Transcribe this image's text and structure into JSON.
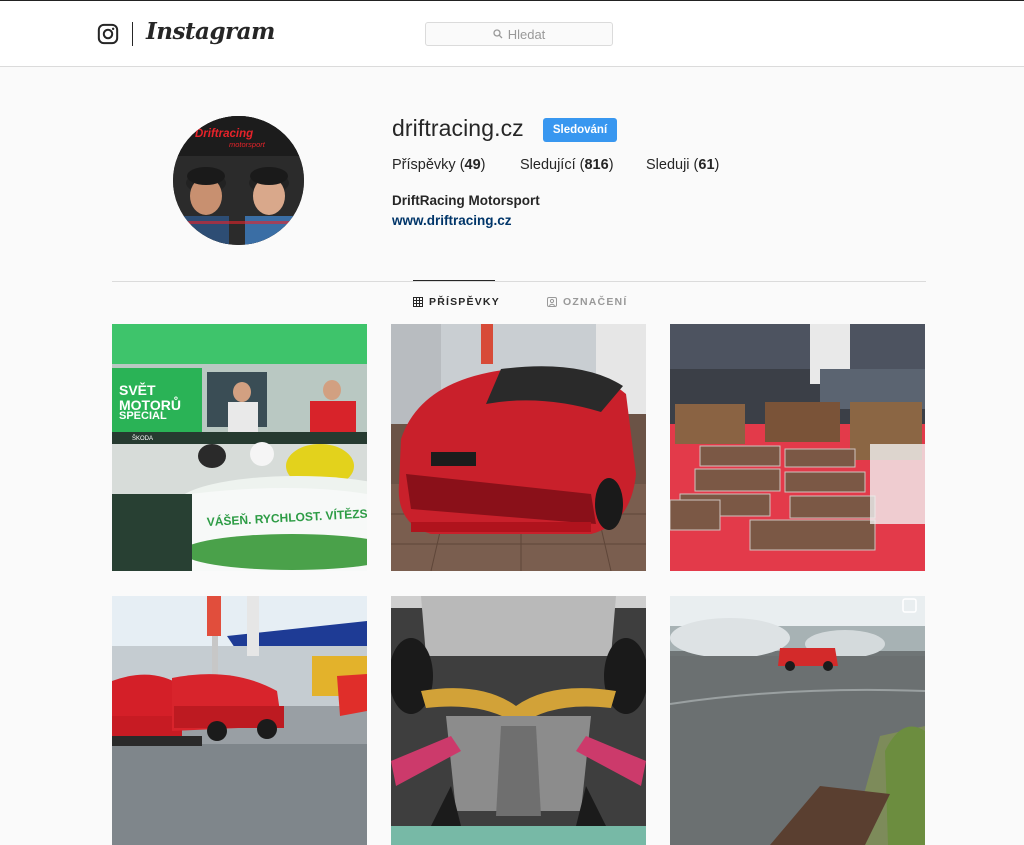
{
  "header": {
    "brand": "Instagram",
    "search_placeholder": "Hledat"
  },
  "profile": {
    "username": "driftracing.cz",
    "follow_button": "Sledování",
    "stats": [
      {
        "label": "Příspěvky",
        "count": "49"
      },
      {
        "label": "Sledující",
        "count": "816"
      },
      {
        "label": "Sleduji",
        "count": "61"
      }
    ],
    "full_name": "DriftRacing Motorsport",
    "website": "www.driftracing.cz",
    "avatar_logo_text": "Driftracing motorsport"
  },
  "tabs": [
    {
      "label": "PŘÍSPĚVKY",
      "active": true
    },
    {
      "label": "OZNAČENÍ",
      "active": false
    }
  ],
  "posts": {
    "tv_show_sign": [
      "SVĚT",
      "MOTORŮ",
      "SPECIAL"
    ],
    "tv_show_desk_text": "VÁŠEŇ. RYCHLOST. VÍTĚZSTVÍ. JI",
    "tv_show_brand_small": "ŠKODA"
  },
  "colors": {
    "accent": "#3897f0",
    "link": "#003569",
    "border": "#dbdbdb"
  }
}
